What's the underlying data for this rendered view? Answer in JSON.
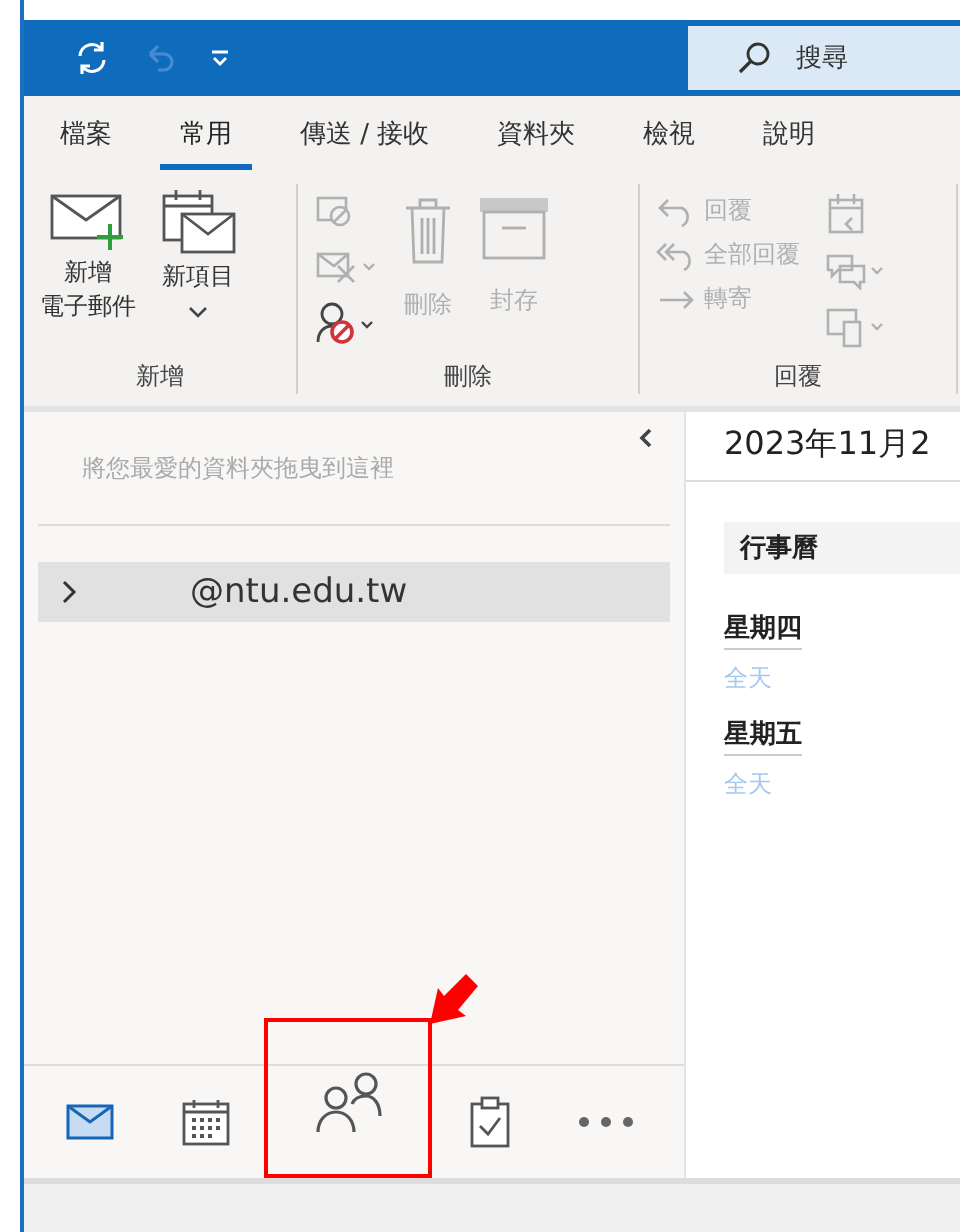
{
  "quick_access": {
    "undo": {
      "disabled": true
    }
  },
  "search": {
    "placeholder": "搜尋"
  },
  "tabs": [
    {
      "label": "檔案",
      "selected": false
    },
    {
      "label": "常用",
      "selected": true
    },
    {
      "label": "傳送 / 接收",
      "selected": false
    },
    {
      "label": "資料夾",
      "selected": false
    },
    {
      "label": "檢視",
      "selected": false
    },
    {
      "label": "說明",
      "selected": false
    }
  ],
  "ribbon": {
    "new": {
      "label": "新增",
      "new_email": {
        "label_lines": [
          "新增",
          "電子郵件"
        ]
      },
      "new_item": {
        "label": "新項目"
      }
    },
    "delete": {
      "label": "刪除",
      "ignore": {
        "disabled": true
      },
      "cleanup": {
        "disabled": true
      },
      "junk": {
        "disabled": false
      },
      "delete": {
        "label": "刪除",
        "disabled": true
      },
      "archive": {
        "label": "封存",
        "disabled": true
      }
    },
    "respond": {
      "label": "回覆",
      "reply": {
        "label": "回覆",
        "disabled": true
      },
      "reply_all": {
        "label": "全部回覆",
        "disabled": true
      },
      "forward": {
        "label": "轉寄",
        "disabled": true
      },
      "meeting": {
        "disabled": true
      },
      "im": {
        "disabled": true
      },
      "more": {
        "disabled": true
      }
    }
  },
  "folder_pane": {
    "favorites_hint": "將您最愛的資料夾拖曳到這裡",
    "account": {
      "label": "@ntu.edu.tw",
      "expanded": false,
      "selected": true
    }
  },
  "todo_pane": {
    "date": "2023年11月2",
    "section": "行事曆",
    "days": [
      {
        "day": "星期四",
        "events": "全天"
      },
      {
        "day": "星期五",
        "events": "全天"
      }
    ]
  },
  "nav": [
    {
      "kind": "mail",
      "selected": true,
      "highlighted": false
    },
    {
      "kind": "calendar",
      "selected": false,
      "highlighted": false
    },
    {
      "kind": "people",
      "selected": false,
      "highlighted": true
    },
    {
      "kind": "tasks",
      "selected": false,
      "highlighted": false
    },
    {
      "kind": "more",
      "selected": false,
      "highlighted": false
    }
  ]
}
